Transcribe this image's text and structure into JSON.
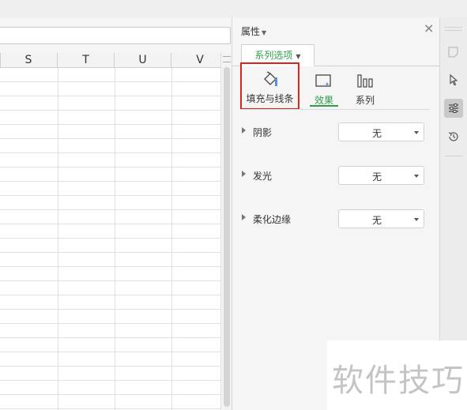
{
  "sheet": {
    "columns": [
      "S",
      "T",
      "U",
      "V"
    ]
  },
  "panel": {
    "title": "属性",
    "close_label": "×",
    "series_tab_label": "系列选项",
    "subtabs": {
      "fill_line": "填充与线条",
      "effect": "效果",
      "series": "系列"
    },
    "properties": [
      {
        "label": "阴影",
        "value": "无"
      },
      {
        "label": "发光",
        "value": "无"
      },
      {
        "label": "柔化边缘",
        "value": "无"
      }
    ]
  },
  "rail": {
    "tools": [
      "shape-icon",
      "pointer-icon",
      "settings-sliders-icon",
      "history-icon"
    ],
    "active_tool": "settings-sliders-icon"
  },
  "watermark": {
    "text": "软件技巧"
  },
  "colors": {
    "accent_green": "#2e9e49",
    "highlight_red": "#d9261c"
  }
}
